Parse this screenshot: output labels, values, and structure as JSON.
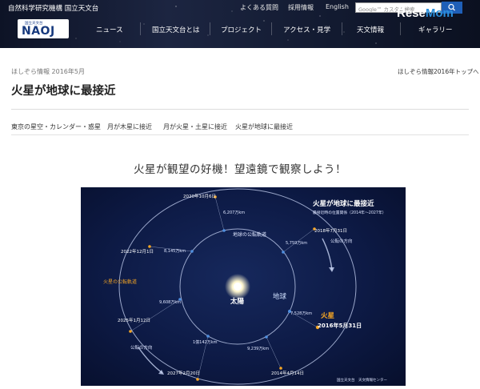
{
  "header": {
    "org_name": "自然科学研究機構 国立天文台",
    "top_links": [
      "よくある質問",
      "採用情報",
      "English"
    ],
    "search_placeholder": "Google™ カスタム検索",
    "logo_small": "国立天文台",
    "logo_text": "NAOJ",
    "nav": [
      "ニュース",
      "国立天文台とは",
      "プロジェクト",
      "アクセス・見学",
      "天文情報",
      "ギャラリー"
    ],
    "watermark": "ReseMom"
  },
  "page": {
    "category": "ほしぞら情報 2016年5月",
    "top_link": "ほしぞら情報2016年トップへ",
    "title": "火星が地球に最接近",
    "subtabs": [
      "東京の星空・カレンダー・惑星",
      "月が木星に接近",
      "月が火星・土星に接近",
      "火星が地球に最接近"
    ],
    "headline": "火星が観望の好機！望遠鏡で観察しよう！"
  },
  "diagram": {
    "title": "火星が地球に最接近",
    "subtitle": "最接近時の位置関係（2014年～2027年）",
    "sun_label": "太陽",
    "earth_label": "地球",
    "mars_label": "火星",
    "mars_date": "2016年5月31日",
    "earth_orbit_label": "地球の公転軌道",
    "mars_orbit_label": "火星の公転軌道",
    "direction_label": "公転の方向",
    "credit": "国立天文台　天文情報センター",
    "approaches": [
      {
        "date": "2020年10月6日",
        "distance": "6,207万km"
      },
      {
        "date": "2018年7月31日",
        "distance": "5,759万km"
      },
      {
        "date": "2016年5月31日",
        "distance": "7,528万km"
      },
      {
        "date": "2014年4月14日",
        "distance": "9,239万km"
      },
      {
        "date": "2027年2月20日",
        "distance": "1億142万km"
      },
      {
        "date": "2025年1月12日",
        "distance": "9,608万km"
      },
      {
        "date": "2022年12月1日",
        "distance": "8,145万km"
      }
    ],
    "colors": {
      "mars": "#f6a623",
      "earth": "#4f8fe0",
      "orbit": "#c9d6f5"
    }
  }
}
